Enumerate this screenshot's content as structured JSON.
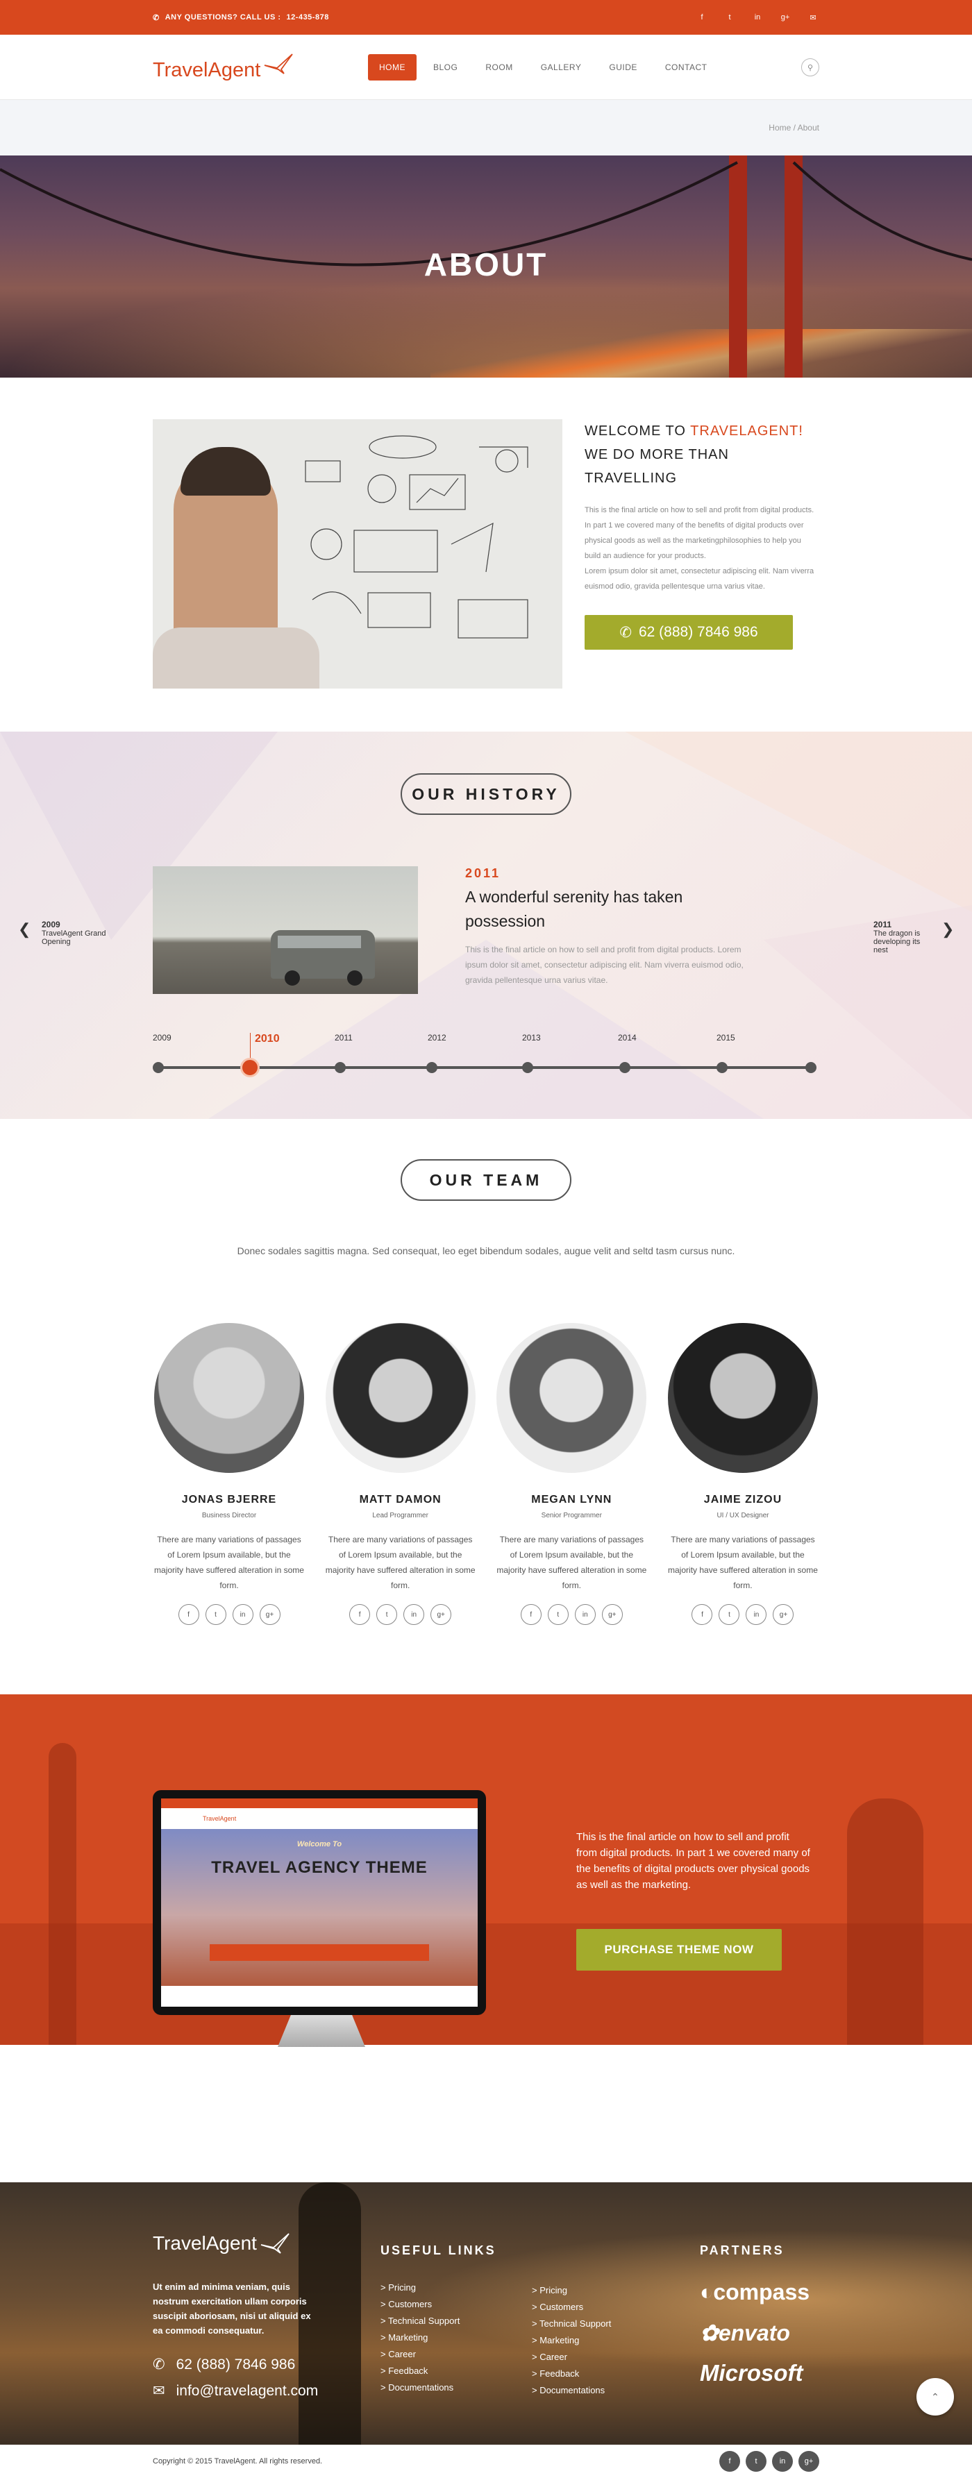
{
  "topbar": {
    "contact_label": "ANY QUESTIONS? CALL US :",
    "phone": "12-435-878",
    "socials": [
      "f",
      "t",
      "in",
      "g+",
      "mail"
    ]
  },
  "header": {
    "logo": "TravelAgent",
    "nav": [
      "HOME",
      "BLOG",
      "ROOM",
      "GALLERY",
      "GUIDE",
      "CONTACT"
    ],
    "active_nav": "HOME",
    "search_icon": "search-icon"
  },
  "breadcrumb": "Home / About",
  "hero": {
    "title": "ABOUT"
  },
  "welcome": {
    "heading_prefix": "WELCOME TO ",
    "heading_brand": "TRAVELAGENT!",
    "heading_line2": "WE DO MORE THAN TRAVELLING",
    "para1": "This is the final article on how to sell and profit from digital products. In part 1 we covered many of the benefits of digital products over physical goods as well as the marketingphilosophies to help you build an audience for your products.",
    "para2": "Lorem ipsum dolor sit amet, consectetur adipiscing elit. Nam viverra euismod odio, gravida pellentesque urna varius vitae.",
    "phone_button": "62 (888) 7846 986"
  },
  "history": {
    "title": "OUR HISTORY",
    "prev": {
      "year": "2009",
      "label": "TravelAgent Grand Opening"
    },
    "next": {
      "year": "2011",
      "label": "The dragon is developing its nest"
    },
    "current": {
      "year": "2011",
      "title": "A wonderful serenity has taken possession",
      "desc": "This is the final article on how to sell and profit from digital products. Lorem ipsum dolor sit amet, consectetur adipiscing elit. Nam viverra euismod odio, gravida pellentesque urna varius vitae."
    },
    "timeline": [
      "2009",
      "2010",
      "2011",
      "2012",
      "2013",
      "2014",
      "2015"
    ],
    "active_year": "2010"
  },
  "team": {
    "title": "OUR TEAM",
    "subtitle": "Donec sodales sagittis magna. Sed consequat, leo eget bibendum sodales, augue velit and seltd tasm cursus nunc.",
    "members": [
      {
        "name": "JONAS BJERRE",
        "role": "Business Director",
        "bio": "There are many variations of passages of Lorem Ipsum available, but the majority have suffered alteration in some form."
      },
      {
        "name": "MATT DAMON",
        "role": "Lead Programmer",
        "bio": "There are many variations of passages of Lorem Ipsum available, but the majority have suffered alteration in some form."
      },
      {
        "name": "MEGAN LYNN",
        "role": "Senior Programmer",
        "bio": "There are many variations of passages of Lorem Ipsum available, but the majority have suffered alteration in some form."
      },
      {
        "name": "JAIME ZIZOU",
        "role": "UI / UX Designer",
        "bio": "There are many variations of passages of Lorem Ipsum available, but the majority have suffered alteration in some form."
      }
    ],
    "member_socials": [
      "f",
      "t",
      "in",
      "g+"
    ]
  },
  "purchase": {
    "text": "This is the final article on how to sell and profit from digital products. In part 1 we covered many of the benefits of digital products over physical goods as well as the marketing.",
    "button": "PURCHASE THEME NOW",
    "screen_logo": "TravelAgent",
    "screen_welcome": "Welcome To",
    "screen_title": "TRAVEL AGENCY THEME"
  },
  "footer": {
    "logo": "TravelAgent",
    "about": "Ut enim ad minima veniam, quis nostrum exercitation  ullam corporis suscipit aboriosam, nisi ut aliquid ex ea commodi consequatur.",
    "phone": "62 (888) 7846 986",
    "email": "info@travelagent.com",
    "links_title": "USEFUL LINKS",
    "links_col1": [
      "Pricing",
      "Customers",
      "Technical Support",
      "Marketing",
      "Career",
      "Feedback",
      "Documentations"
    ],
    "links_col2": [
      "Pricing",
      "Customers",
      "Technical Support",
      "Marketing",
      "Career",
      "Feedback",
      "Documentations"
    ],
    "partners_title": "PARTNERS",
    "partners": [
      "compass",
      "envato",
      "Microsoft"
    ],
    "copyright": "Copyright © 2015 TravelAgent. All rights reserved.",
    "socials": [
      "f",
      "t",
      "in",
      "g+"
    ]
  }
}
